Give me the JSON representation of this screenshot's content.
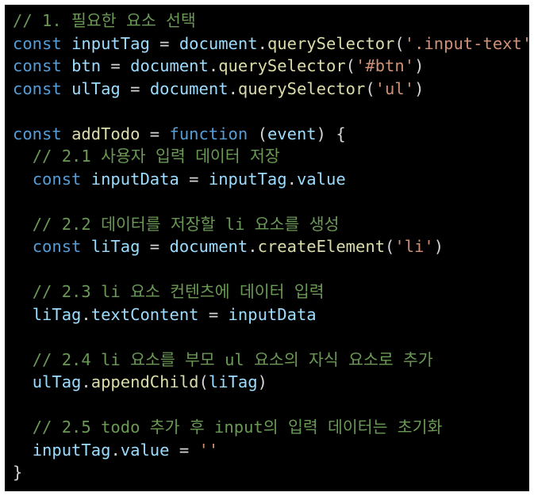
{
  "editor": {
    "background": "#000000",
    "colors": {
      "keyword": "#569cd6",
      "variable": "#9cdcfe",
      "function": "#dcdcaa",
      "string": "#ce9178",
      "comment": "#6a9955",
      "plain": "#d4d4d4"
    },
    "lines": [
      [
        {
          "t": "// 1. 필요한 요소 선택",
          "c": "cm"
        }
      ],
      [
        {
          "t": "const",
          "c": "kw"
        },
        {
          "t": " ",
          "c": "pl"
        },
        {
          "t": "inputTag",
          "c": "var"
        },
        {
          "t": " = ",
          "c": "pl"
        },
        {
          "t": "document",
          "c": "var"
        },
        {
          "t": ".",
          "c": "pl"
        },
        {
          "t": "querySelector",
          "c": "fn"
        },
        {
          "t": "(",
          "c": "pl"
        },
        {
          "t": "'.input-text'",
          "c": "str"
        },
        {
          "t": ")",
          "c": "pl"
        }
      ],
      [
        {
          "t": "const",
          "c": "kw"
        },
        {
          "t": " ",
          "c": "pl"
        },
        {
          "t": "btn",
          "c": "var"
        },
        {
          "t": " = ",
          "c": "pl"
        },
        {
          "t": "document",
          "c": "var"
        },
        {
          "t": ".",
          "c": "pl"
        },
        {
          "t": "querySelector",
          "c": "fn"
        },
        {
          "t": "(",
          "c": "pl"
        },
        {
          "t": "'#btn'",
          "c": "str"
        },
        {
          "t": ")",
          "c": "pl"
        }
      ],
      [
        {
          "t": "const",
          "c": "kw"
        },
        {
          "t": " ",
          "c": "pl"
        },
        {
          "t": "ulTag",
          "c": "var"
        },
        {
          "t": " = ",
          "c": "pl"
        },
        {
          "t": "document",
          "c": "var"
        },
        {
          "t": ".",
          "c": "pl"
        },
        {
          "t": "querySelector",
          "c": "fn"
        },
        {
          "t": "(",
          "c": "pl"
        },
        {
          "t": "'ul'",
          "c": "str"
        },
        {
          "t": ")",
          "c": "pl"
        }
      ],
      [],
      [
        {
          "t": "const",
          "c": "kw"
        },
        {
          "t": " ",
          "c": "pl"
        },
        {
          "t": "addTodo",
          "c": "fn"
        },
        {
          "t": " = ",
          "c": "pl"
        },
        {
          "t": "function",
          "c": "kw"
        },
        {
          "t": " (",
          "c": "pl"
        },
        {
          "t": "event",
          "c": "var"
        },
        {
          "t": ") {",
          "c": "pl"
        }
      ],
      [
        {
          "t": "  ",
          "c": "pl"
        },
        {
          "t": "// 2.1 사용자 입력 데이터 저장",
          "c": "cm"
        }
      ],
      [
        {
          "t": "  ",
          "c": "pl"
        },
        {
          "t": "const",
          "c": "kw"
        },
        {
          "t": " ",
          "c": "pl"
        },
        {
          "t": "inputData",
          "c": "var"
        },
        {
          "t": " = ",
          "c": "pl"
        },
        {
          "t": "inputTag",
          "c": "var"
        },
        {
          "t": ".",
          "c": "pl"
        },
        {
          "t": "value",
          "c": "var"
        }
      ],
      [],
      [
        {
          "t": "  ",
          "c": "pl"
        },
        {
          "t": "// 2.2 데이터를 저장할 li 요소를 생성",
          "c": "cm"
        }
      ],
      [
        {
          "t": "  ",
          "c": "pl"
        },
        {
          "t": "const",
          "c": "kw"
        },
        {
          "t": " ",
          "c": "pl"
        },
        {
          "t": "liTag",
          "c": "var"
        },
        {
          "t": " = ",
          "c": "pl"
        },
        {
          "t": "document",
          "c": "var"
        },
        {
          "t": ".",
          "c": "pl"
        },
        {
          "t": "createElement",
          "c": "fn"
        },
        {
          "t": "(",
          "c": "pl"
        },
        {
          "t": "'li'",
          "c": "str"
        },
        {
          "t": ")",
          "c": "pl"
        }
      ],
      [],
      [
        {
          "t": "  ",
          "c": "pl"
        },
        {
          "t": "// 2.3 li 요소 컨텐츠에 데이터 입력",
          "c": "cm"
        }
      ],
      [
        {
          "t": "  ",
          "c": "pl"
        },
        {
          "t": "liTag",
          "c": "var"
        },
        {
          "t": ".",
          "c": "pl"
        },
        {
          "t": "textContent",
          "c": "var"
        },
        {
          "t": " = ",
          "c": "pl"
        },
        {
          "t": "inputData",
          "c": "var"
        }
      ],
      [],
      [
        {
          "t": "  ",
          "c": "pl"
        },
        {
          "t": "// 2.4 li 요소를 부모 ul 요소의 자식 요소로 추가",
          "c": "cm"
        }
      ],
      [
        {
          "t": "  ",
          "c": "pl"
        },
        {
          "t": "ulTag",
          "c": "var"
        },
        {
          "t": ".",
          "c": "pl"
        },
        {
          "t": "appendChild",
          "c": "fn"
        },
        {
          "t": "(",
          "c": "pl"
        },
        {
          "t": "liTag",
          "c": "var"
        },
        {
          "t": ")",
          "c": "pl"
        }
      ],
      [],
      [
        {
          "t": "  ",
          "c": "pl"
        },
        {
          "t": "// 2.5 todo 추가 후 input의 입력 데이터는 초기화",
          "c": "cm"
        }
      ],
      [
        {
          "t": "  ",
          "c": "pl"
        },
        {
          "t": "inputTag",
          "c": "var"
        },
        {
          "t": ".",
          "c": "pl"
        },
        {
          "t": "value",
          "c": "var"
        },
        {
          "t": " = ",
          "c": "pl"
        },
        {
          "t": "''",
          "c": "str"
        }
      ],
      [
        {
          "t": "}",
          "c": "pl"
        }
      ]
    ]
  }
}
